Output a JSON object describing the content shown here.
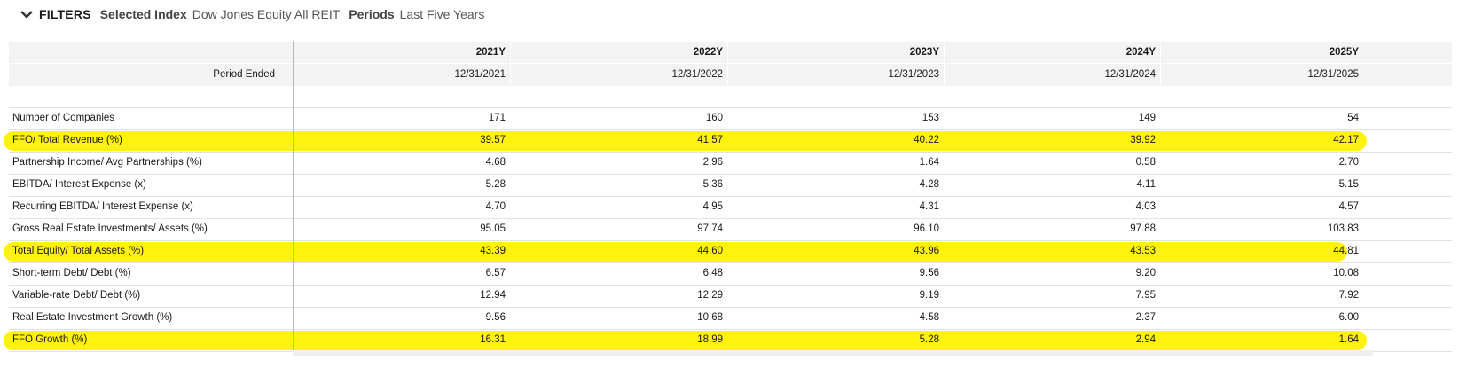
{
  "filters": {
    "title": "FILTERS",
    "index_label": "Selected Index",
    "index_value": "Dow Jones Equity All REIT",
    "periods_label": "Periods",
    "periods_value": "Last Five Years"
  },
  "table": {
    "columns": [
      "2021Y",
      "2022Y",
      "2023Y",
      "2024Y",
      "2025Y"
    ],
    "period_label": "Period Ended",
    "period_dates": [
      "12/31/2021",
      "12/31/2022",
      "12/31/2023",
      "12/31/2024",
      "12/31/2025"
    ],
    "rows": [
      {
        "label": "Number of Companies",
        "values": [
          "171",
          "160",
          "153",
          "149",
          "54"
        ]
      },
      {
        "label": "FFO/ Total Revenue (%)",
        "values": [
          "39.57",
          "41.57",
          "40.22",
          "39.92",
          "42.17"
        ]
      },
      {
        "label": "Partnership Income/ Avg Partnerships (%)",
        "values": [
          "4.68",
          "2.96",
          "1.64",
          "0.58",
          "2.70"
        ]
      },
      {
        "label": "EBITDA/ Interest Expense (x)",
        "values": [
          "5.28",
          "5.36",
          "4.28",
          "4.11",
          "5.15"
        ]
      },
      {
        "label": "Recurring EBITDA/ Interest Expense (x)",
        "values": [
          "4.70",
          "4.95",
          "4.31",
          "4.03",
          "4.57"
        ]
      },
      {
        "label": "Gross Real Estate Investments/ Assets (%)",
        "values": [
          "95.05",
          "97.74",
          "96.10",
          "97.88",
          "103.83"
        ]
      },
      {
        "label": "Total Equity/ Total Assets (%)",
        "values": [
          "43.39",
          "44.60",
          "43.96",
          "43.53",
          "44.81"
        ]
      },
      {
        "label": "Short-term Debt/ Debt (%)",
        "values": [
          "6.57",
          "6.48",
          "9.56",
          "9.20",
          "10.08"
        ]
      },
      {
        "label": "Variable-rate Debt/ Debt (%)",
        "values": [
          "12.94",
          "12.29",
          "9.19",
          "7.95",
          "7.92"
        ]
      },
      {
        "label": "Real Estate Investment Growth (%)",
        "values": [
          "9.56",
          "10.68",
          "4.58",
          "2.37",
          "6.00"
        ]
      },
      {
        "label": "FFO Growth (%)",
        "values": [
          "16.31",
          "18.99",
          "5.28",
          "2.94",
          "1.64"
        ]
      }
    ]
  },
  "colors": {
    "highlight": "#fff200",
    "header_bg": "#f3f3f3"
  }
}
